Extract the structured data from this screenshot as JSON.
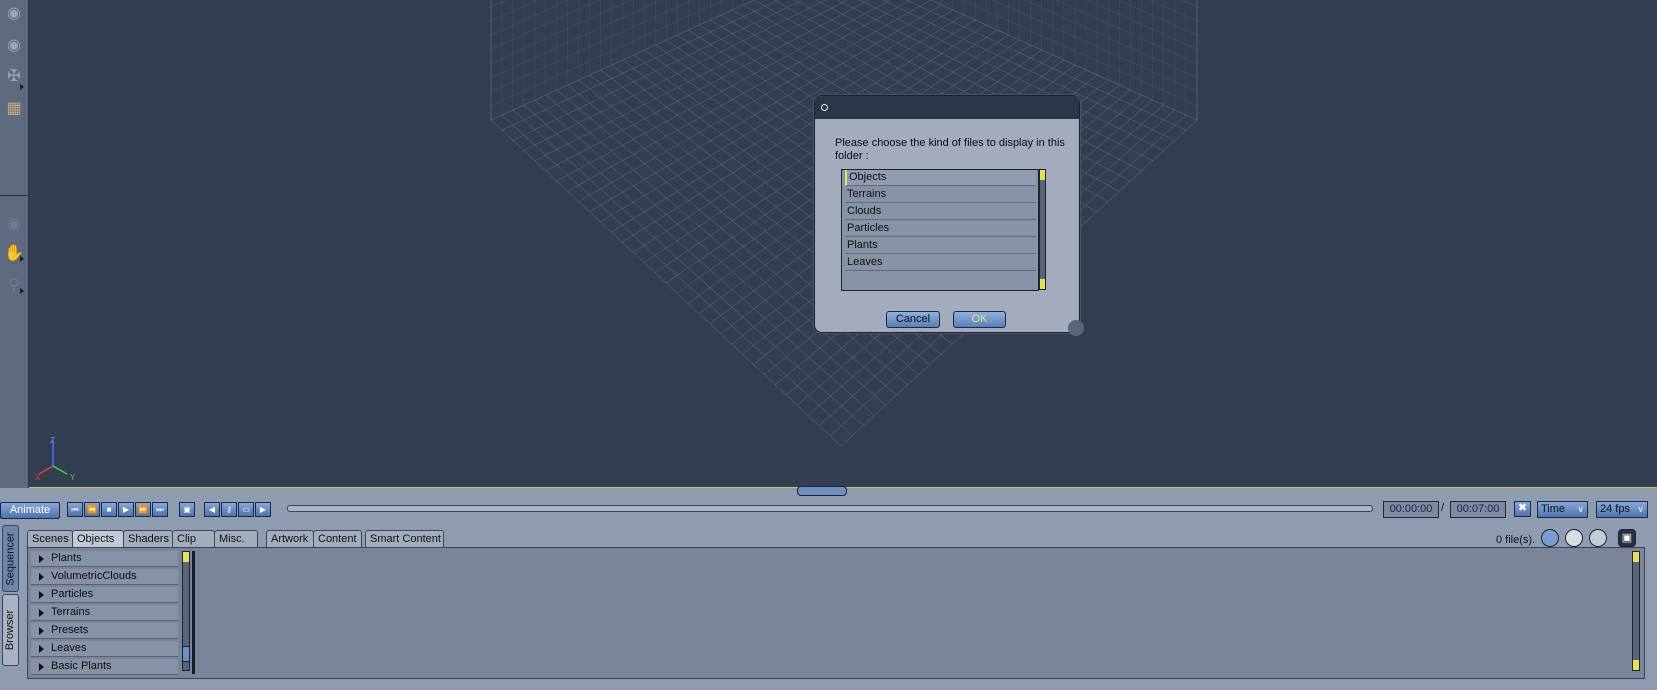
{
  "dialog": {
    "message": "Please choose the kind of files to display in this folder :",
    "file_types": [
      "Objects",
      "Terrains",
      "Clouds",
      "Particles",
      "Plants",
      "Leaves"
    ],
    "selected": "Objects",
    "cancel_label": "Cancel",
    "ok_label": "OK"
  },
  "toolbar": {
    "icons": [
      "camera-icon",
      "camera-icon",
      "orbit-icon",
      "cube-icon",
      "camera-icon",
      "hand-icon",
      "zoom-icon"
    ]
  },
  "animation": {
    "animate_label": "Animate",
    "current_time": "00:00:00",
    "separator": "/",
    "total_time": "00:07:00",
    "time_mode": "Time",
    "fps": "24 fps"
  },
  "browser": {
    "side_tabs": [
      "Sequencer",
      "Browser"
    ],
    "tabs": [
      "Scenes",
      "Objects",
      "Shaders",
      "Clip",
      "Misc.",
      "Artwork",
      "Content",
      "Smart Content"
    ],
    "active_tab": "Objects",
    "file_count": "0 file(s).",
    "folders": [
      "Plants",
      "VolumetricClouds",
      "Particles",
      "Terrains",
      "Presets",
      "Leaves",
      "Basic Plants"
    ]
  },
  "viewport": {
    "axis_labels": [
      "Z",
      "X",
      "Y"
    ]
  },
  "colors": {
    "viewport_bg": "#333e51",
    "grid_line": "#6a7588",
    "accent_yellow": "#e6df58",
    "button_blue": "#5b7fb6"
  }
}
